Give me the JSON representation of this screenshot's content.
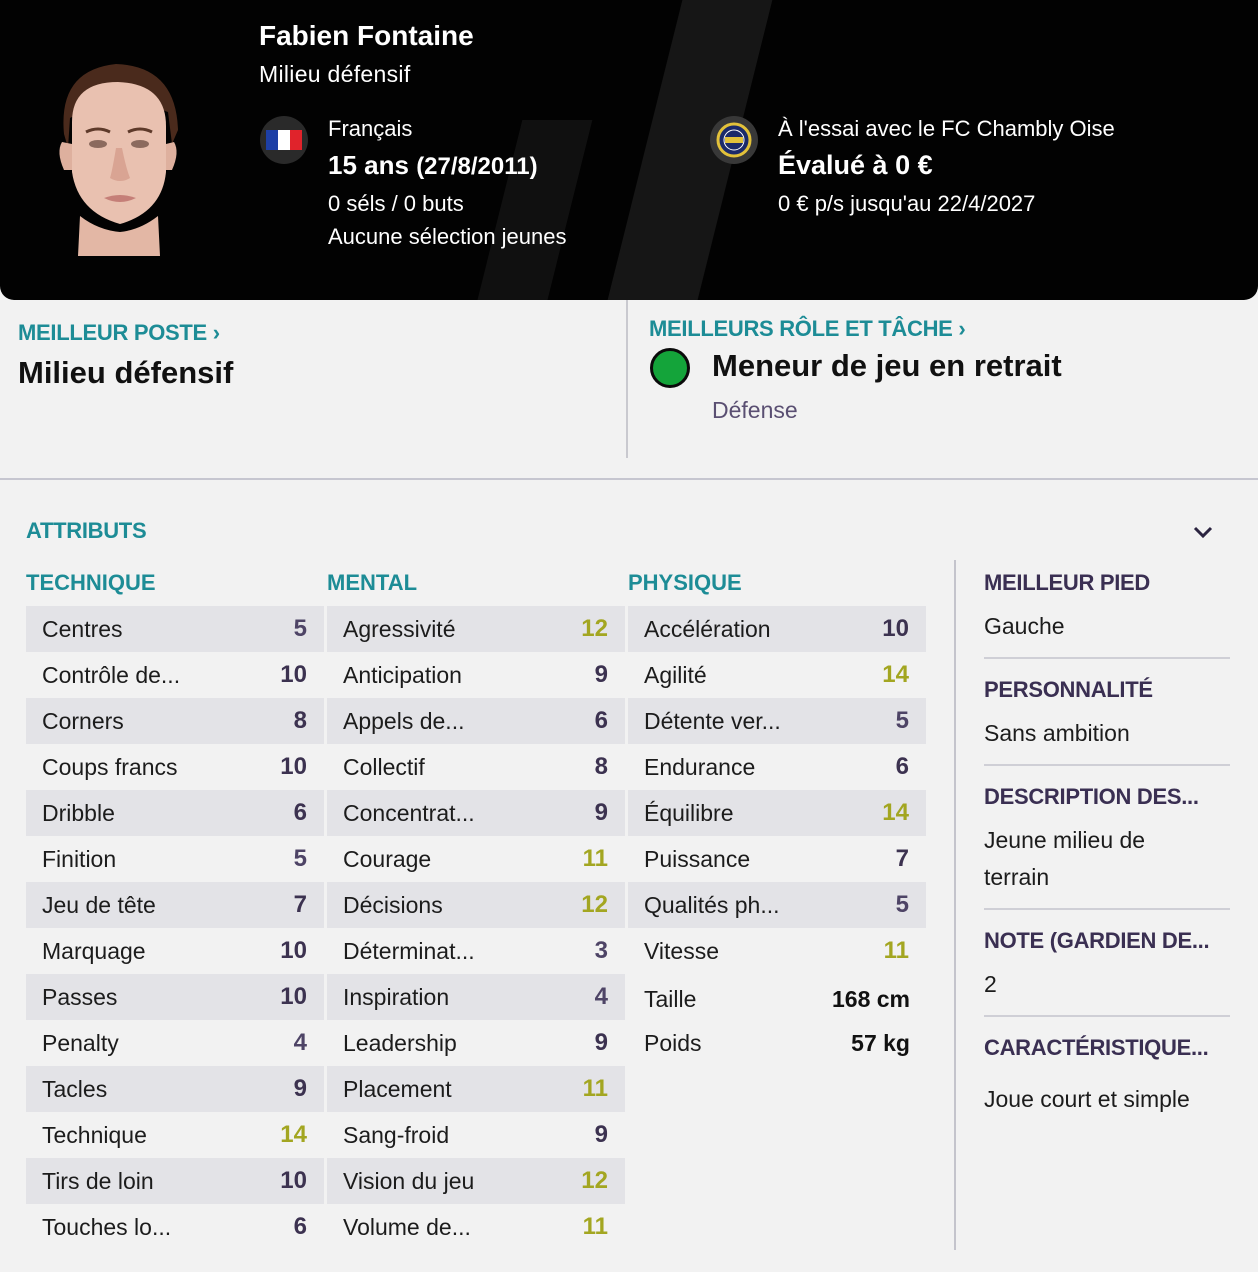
{
  "player": {
    "name": "Fabien Fontaine",
    "position": "Milieu défensif",
    "nationality": "Français",
    "age": "15 ans",
    "dob": "(27/8/2011)",
    "caps": "0 séls / 0 buts",
    "youth_caps": "Aucune sélection jeunes",
    "status": "À l'essai avec le FC Chambly Oise",
    "value": "Évalué à 0 €",
    "wage": "0 € p/s jusqu'au 22/4/2027"
  },
  "best_position": {
    "heading": "MEILLEUR POSTE",
    "value": "Milieu défensif"
  },
  "best_role": {
    "heading": "MEILLEURS RÔLE ET TÂCHE",
    "role": "Meneur de jeu en retrait",
    "duty": "Défense",
    "indicator_color": "#14a43a"
  },
  "attributes": {
    "title": "ATTRIBUTS",
    "technique": {
      "heading": "TECHNIQUE",
      "items": [
        {
          "label": "Centres",
          "value": "5"
        },
        {
          "label": "Contrôle de...",
          "value": "10"
        },
        {
          "label": "Corners",
          "value": "8"
        },
        {
          "label": "Coups francs",
          "value": "10"
        },
        {
          "label": "Dribble",
          "value": "6"
        },
        {
          "label": "Finition",
          "value": "5"
        },
        {
          "label": "Jeu de tête",
          "value": "7"
        },
        {
          "label": "Marquage",
          "value": "10"
        },
        {
          "label": "Passes",
          "value": "10"
        },
        {
          "label": "Penalty",
          "value": "4"
        },
        {
          "label": "Tacles",
          "value": "9"
        },
        {
          "label": "Technique",
          "value": "14"
        },
        {
          "label": "Tirs de loin",
          "value": "10"
        },
        {
          "label": "Touches lo...",
          "value": "6"
        }
      ]
    },
    "mental": {
      "heading": "MENTAL",
      "items": [
        {
          "label": "Agressivité",
          "value": "12"
        },
        {
          "label": "Anticipation",
          "value": "9"
        },
        {
          "label": "Appels de...",
          "value": "6"
        },
        {
          "label": "Collectif",
          "value": "8"
        },
        {
          "label": "Concentrat...",
          "value": "9"
        },
        {
          "label": "Courage",
          "value": "11"
        },
        {
          "label": "Décisions",
          "value": "12"
        },
        {
          "label": "Déterminat...",
          "value": "3"
        },
        {
          "label": "Inspiration",
          "value": "4"
        },
        {
          "label": "Leadership",
          "value": "9"
        },
        {
          "label": "Placement",
          "value": "11"
        },
        {
          "label": "Sang-froid",
          "value": "9"
        },
        {
          "label": "Vision du jeu",
          "value": "12"
        },
        {
          "label": "Volume de...",
          "value": "11"
        }
      ]
    },
    "physique": {
      "heading": "PHYSIQUE",
      "items": [
        {
          "label": "Accélération",
          "value": "10"
        },
        {
          "label": "Agilité",
          "value": "14"
        },
        {
          "label": "Détente ver...",
          "value": "5"
        },
        {
          "label": "Endurance",
          "value": "6"
        },
        {
          "label": "Équilibre",
          "value": "14"
        },
        {
          "label": "Puissance",
          "value": "7"
        },
        {
          "label": "Qualités ph...",
          "value": "5"
        },
        {
          "label": "Vitesse",
          "value": "11"
        }
      ],
      "height_label": "Taille",
      "height": "168 cm",
      "weight_label": "Poids",
      "weight": "57 kg"
    }
  },
  "side_info": [
    {
      "label": "MEILLEUR PIED",
      "value": "Gauche"
    },
    {
      "label": "PERSONNALITÉ",
      "value": "Sans ambition"
    },
    {
      "label": "DESCRIPTION DES...",
      "value": "Jeune milieu de terrain"
    },
    {
      "label": "NOTE (GARDIEN DE...",
      "value": "2"
    },
    {
      "label": "CARACTÉRISTIQUE...",
      "value": "Joue court et simple"
    }
  ],
  "colors": {
    "accent_teal": "#1d8c96",
    "rating_high": "#a3a621",
    "rating_mid": "#3c3250",
    "header_bg": "#020202"
  },
  "icons": {
    "flag": "france-flag-icon",
    "club": "fc-chambly-crest-icon",
    "expand": "chevron-down-icon"
  }
}
